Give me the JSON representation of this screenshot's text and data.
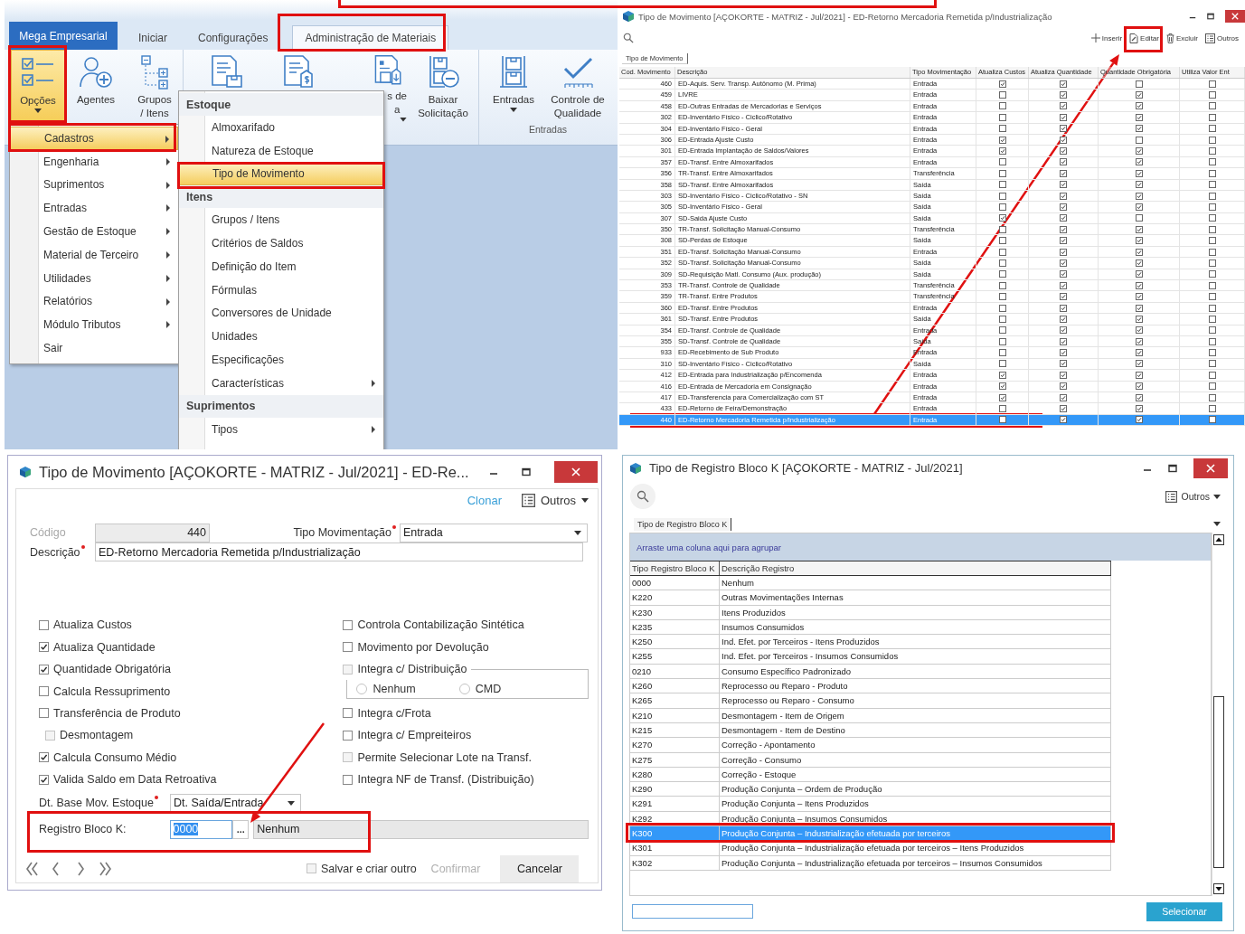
{
  "main_window": {
    "tabs": [
      {
        "label": "Mega Empresarial",
        "kind": "app",
        "selected": false
      },
      {
        "label": "Iniciar",
        "kind": "tab",
        "selected": false
      },
      {
        "label": "Configurações",
        "kind": "tab",
        "selected": false
      },
      {
        "label": "Administração de Materiais",
        "kind": "tab",
        "selected": true
      }
    ],
    "ribbon_groups": [
      {
        "buttons": [
          {
            "label_lines": [
              "Opções"
            ],
            "caret": true,
            "selected": true
          },
          {
            "label_lines": [
              "Agentes"
            ],
            "caret": false,
            "selected": false
          },
          {
            "label_lines": [
              "Grupos",
              "/ Itens"
            ],
            "caret": false,
            "selected": false
          }
        ]
      },
      {
        "buttons": [
          {
            "caret": false,
            "selected": false
          },
          {
            "caret": false,
            "selected": false
          },
          {
            "label_lines": [
              "s de",
              "a"
            ],
            "caret": true,
            "selected": false
          },
          {
            "label_lines": [
              "Baixar",
              "Solicitação"
            ],
            "caret": false,
            "selected": false
          }
        ]
      },
      {
        "caption": "Entradas",
        "buttons": [
          {
            "label_lines": [
              "Entradas"
            ],
            "caret": true,
            "selected": false
          },
          {
            "label_lines": [
              "Controle de",
              "Qualidade"
            ],
            "caret": false,
            "selected": false
          }
        ]
      }
    ],
    "menu": [
      {
        "label": "Cadastros",
        "has_submenu": true,
        "selected": true
      },
      {
        "label": "Engenharia",
        "has_submenu": true,
        "selected": false
      },
      {
        "label": "Suprimentos",
        "has_submenu": true,
        "selected": false
      },
      {
        "label": "Entradas",
        "has_submenu": true,
        "selected": false
      },
      {
        "label": "Gestão de Estoque",
        "has_submenu": true,
        "selected": false
      },
      {
        "label": "Material de Terceiro",
        "has_submenu": true,
        "selected": false
      },
      {
        "label": "Utilidades",
        "has_submenu": true,
        "selected": false
      },
      {
        "label": "Relatórios",
        "has_submenu": true,
        "selected": false
      },
      {
        "label": "Módulo Tributos",
        "has_submenu": true,
        "selected": false
      },
      {
        "label": "Sair",
        "has_submenu": false,
        "selected": false
      }
    ],
    "submenu": [
      {
        "header": "Estoque",
        "items": [
          {
            "label": "Almoxarifado",
            "has_submenu": false,
            "selected": false
          },
          {
            "label": "Natureza de Estoque",
            "has_submenu": false,
            "selected": false
          },
          {
            "label": "Tipo de Movimento",
            "has_submenu": false,
            "selected": true
          }
        ]
      },
      {
        "header": "Itens",
        "items": [
          {
            "label": "Grupos / Itens",
            "has_submenu": false,
            "selected": false
          },
          {
            "label": "Critérios de Saldos",
            "has_submenu": false,
            "selected": false
          },
          {
            "label": "Definição do Item",
            "has_submenu": false,
            "selected": false
          },
          {
            "label": "Fórmulas",
            "has_submenu": false,
            "selected": false
          },
          {
            "label": "Conversores de Unidade",
            "has_submenu": false,
            "selected": false
          },
          {
            "label": "Unidades",
            "has_submenu": false,
            "selected": false
          },
          {
            "label": "Especificações",
            "has_submenu": false,
            "selected": false
          },
          {
            "label": "Características",
            "has_submenu": true,
            "selected": false
          }
        ]
      },
      {
        "header": "Suprimentos",
        "items": [
          {
            "label": "Tipos",
            "has_submenu": true,
            "selected": false
          }
        ]
      }
    ]
  },
  "movement_list_window": {
    "title": "Tipo de Movimento [AÇOKORTE - MATRIZ - Jul/2021] - ED-Retorno Mercadoria Remetida p/Industrialização",
    "toolbar": [
      {
        "label": "Inserir"
      },
      {
        "label": "Editar"
      },
      {
        "label": "Excluir"
      },
      {
        "label": "Outros"
      }
    ],
    "tab": "Tipo de Movimento",
    "columns": [
      "Cod. Movimento",
      "Descrição",
      "Tipo Movimentação",
      "Atualiza Custos",
      "Atualiza Quantidade",
      "Quantidade Obrigatória",
      "Utiliza Valor Ent"
    ],
    "rows": [
      {
        "code": "460",
        "description": "ED-Aquis. Serv. Transp. Autônomo (M. Prima)",
        "type": "Entrada",
        "flags": [
          true,
          true,
          false,
          false
        ],
        "selected": false
      },
      {
        "code": "459",
        "description": "LIVRE",
        "type": "Entrada",
        "flags": [
          false,
          true,
          true,
          false
        ],
        "selected": false
      },
      {
        "code": "458",
        "description": "ED-Outras Entradas de Mercadorias e Serviços",
        "type": "Entrada",
        "flags": [
          false,
          true,
          true,
          false
        ],
        "selected": false
      },
      {
        "code": "302",
        "description": "ED-Inventário Físico - Ciclico/Rotativo",
        "type": "Entrada",
        "flags": [
          false,
          true,
          true,
          false
        ],
        "selected": false
      },
      {
        "code": "304",
        "description": "ED-Inventário Físico - Geral",
        "type": "Entrada",
        "flags": [
          false,
          true,
          true,
          false
        ],
        "selected": false
      },
      {
        "code": "306",
        "description": "ED-Entrada Ajuste Custo",
        "type": "Entrada",
        "flags": [
          true,
          true,
          false,
          false
        ],
        "selected": false
      },
      {
        "code": "301",
        "description": "ED-Entrada Implantação de Saldos/Valores",
        "type": "Entrada",
        "flags": [
          true,
          true,
          true,
          false
        ],
        "selected": false
      },
      {
        "code": "357",
        "description": "ED-Transf. Entre Almoxarifados",
        "type": "Entrada",
        "flags": [
          false,
          true,
          true,
          false
        ],
        "selected": false
      },
      {
        "code": "356",
        "description": "TR-Transf. Entre Almoxarifados",
        "type": "Transferência",
        "flags": [
          false,
          true,
          true,
          false
        ],
        "selected": false
      },
      {
        "code": "358",
        "description": "SD-Transf. Entre Almoxarifados",
        "type": "Saída",
        "flags": [
          false,
          true,
          true,
          false
        ],
        "selected": false
      },
      {
        "code": "303",
        "description": "SD-Inventário Físico - Ciclico/Rotativo - SN",
        "type": "Saída",
        "flags": [
          false,
          true,
          true,
          false
        ],
        "selected": false
      },
      {
        "code": "305",
        "description": "SD-Inventário Físico - Geral",
        "type": "Saída",
        "flags": [
          false,
          true,
          true,
          false
        ],
        "selected": false
      },
      {
        "code": "307",
        "description": "SD-Saida Ajuste Custo",
        "type": "Saída",
        "flags": [
          true,
          true,
          false,
          false
        ],
        "selected": false
      },
      {
        "code": "350",
        "description": "TR-Transf. Solicitação Manual-Consumo",
        "type": "Transferência",
        "flags": [
          false,
          true,
          true,
          false
        ],
        "selected": false
      },
      {
        "code": "308",
        "description": "SD-Perdas de Estoque",
        "type": "Saída",
        "flags": [
          false,
          true,
          true,
          false
        ],
        "selected": false
      },
      {
        "code": "351",
        "description": "ED-Transf. Solicitação Manual-Consumo",
        "type": "Entrada",
        "flags": [
          false,
          true,
          true,
          false
        ],
        "selected": false
      },
      {
        "code": "352",
        "description": "SD-Transf. Solicitação Manual-Consumo",
        "type": "Saída",
        "flags": [
          false,
          true,
          true,
          false
        ],
        "selected": false
      },
      {
        "code": "309",
        "description": "SD-Requisição Matl. Consumo (Aux. produção)",
        "type": "Saída",
        "flags": [
          false,
          true,
          true,
          false
        ],
        "selected": false
      },
      {
        "code": "353",
        "description": "TR-Transf. Controle de Qualidade",
        "type": "Transferência",
        "flags": [
          false,
          true,
          true,
          false
        ],
        "selected": false
      },
      {
        "code": "359",
        "description": "TR-Transf. Entre Produtos",
        "type": "Transferência",
        "flags": [
          false,
          true,
          true,
          false
        ],
        "selected": false
      },
      {
        "code": "360",
        "description": "ED-Transf. Entre Produtos",
        "type": "Entrada",
        "flags": [
          false,
          true,
          true,
          false
        ],
        "selected": false
      },
      {
        "code": "361",
        "description": "SD-Transf. Entre Produtos",
        "type": "Saída",
        "flags": [
          false,
          true,
          true,
          false
        ],
        "selected": false
      },
      {
        "code": "354",
        "description": "ED-Transf. Controle de Qualidade",
        "type": "Entrada",
        "flags": [
          false,
          true,
          true,
          false
        ],
        "selected": false
      },
      {
        "code": "355",
        "description": "SD-Transf. Controle de Qualidade",
        "type": "Saída",
        "flags": [
          false,
          true,
          true,
          false
        ],
        "selected": false
      },
      {
        "code": "933",
        "description": "ED-Recebimento de Sub Produto",
        "type": "Entrada",
        "flags": [
          false,
          true,
          true,
          false
        ],
        "selected": false
      },
      {
        "code": "310",
        "description": "SD-Inventário Físico - Ciclico/Rotativo",
        "type": "Saída",
        "flags": [
          false,
          true,
          true,
          false
        ],
        "selected": false
      },
      {
        "code": "412",
        "description": "ED-Entrada para Industrialização p/Encomenda",
        "type": "Entrada",
        "flags": [
          true,
          true,
          true,
          false
        ],
        "selected": false
      },
      {
        "code": "416",
        "description": "ED-Entrada de Mercadoria em Consignação",
        "type": "Entrada",
        "flags": [
          true,
          true,
          true,
          false
        ],
        "selected": false
      },
      {
        "code": "417",
        "description": "ED-Transferencia para Comercialização com ST",
        "type": "Entrada",
        "flags": [
          true,
          true,
          true,
          false
        ],
        "selected": false
      },
      {
        "code": "433",
        "description": "ED-Retorno de Feira/Demonstração",
        "type": "Entrada",
        "flags": [
          false,
          true,
          true,
          false
        ],
        "selected": false
      },
      {
        "code": "440",
        "description": "ED-Retorno Mercadoria Remetida p/Industrialização",
        "type": "Entrada",
        "flags": [
          false,
          true,
          true,
          false
        ],
        "selected": true
      }
    ]
  },
  "movement_dialog": {
    "title": "Tipo de Movimento [AÇOKORTE - MATRIZ - Jul/2021] - ED-Re...",
    "clone_link": "Clonar",
    "more_menu": "Outros",
    "code_field": {
      "label": "Código",
      "value": "440",
      "disabled": true
    },
    "movement_type_field": {
      "label": "Tipo Movimentação",
      "value": "Entrada",
      "required": true
    },
    "description_field": {
      "label": "Descrição",
      "value": "ED-Retorno Mercadoria Remetida p/Industrialização",
      "required": true
    },
    "left_options": [
      {
        "label": "Atualiza Custos",
        "checked": false,
        "disabled": false
      },
      {
        "label": "Atualiza Quantidade",
        "checked": true,
        "disabled": false
      },
      {
        "label": "Quantidade Obrigatória",
        "checked": true,
        "disabled": false
      },
      {
        "label": "Calcula Ressuprimento",
        "checked": false,
        "disabled": false
      },
      {
        "label": "Transferência de Produto",
        "checked": false,
        "disabled": false,
        "children": [
          {
            "label": "Desmontagem",
            "checked": false,
            "disabled": true
          }
        ]
      },
      {
        "label": "Calcula Consumo Médio",
        "checked": true,
        "disabled": false
      },
      {
        "label": "Valida Saldo em Data Retroativa",
        "checked": true,
        "disabled": false
      }
    ],
    "right_options": [
      {
        "kind": "check",
        "label": "Controla Contabilização Sintética",
        "checked": false,
        "disabled": false
      },
      {
        "kind": "check",
        "label": "Movimento por Devolução",
        "checked": false,
        "disabled": false
      },
      {
        "kind": "group",
        "label": "Integra c/ Distribuição",
        "checked": false,
        "disabled": true,
        "radios": [
          {
            "label": "Nenhum",
            "selected": false
          },
          {
            "label": "CMD",
            "selected": false
          }
        ]
      },
      {
        "kind": "check",
        "label": "Integra c/Frota",
        "checked": false,
        "disabled": false
      },
      {
        "kind": "check",
        "label": "Integra c/ Empreiteiros",
        "checked": false,
        "disabled": false
      },
      {
        "kind": "check",
        "label": "Permite Selecionar Lote na Transf.",
        "checked": false,
        "disabled": true
      },
      {
        "kind": "check",
        "label": "Integra NF de Transf. (Distribuição)",
        "checked": false,
        "disabled": false
      }
    ],
    "stock_date_field": {
      "label": "Dt. Base Mov. Estoque",
      "value": "Dt. Saída/Entrada",
      "required": true
    },
    "bloco_k_field": {
      "label": "Registro Bloco K:",
      "value": "0000",
      "value_selected": true,
      "browse": "...",
      "description": "Nenhum"
    },
    "save_and_new": {
      "label": "Salvar e criar outro",
      "checked": false,
      "disabled": true
    },
    "buttons": [
      {
        "label": "Confirmar",
        "disabled": true
      },
      {
        "label": "Cancelar",
        "disabled": false
      }
    ]
  },
  "bloco_k_window": {
    "title": "Tipo de Registro Bloco K [AÇOKORTE - MATRIZ - Jul/2021]",
    "more_menu": "Outros",
    "tab": "Tipo de Registro Bloco K",
    "group_hint": "Arraste uma coluna aqui para agrupar",
    "columns": [
      "Tipo Registro Bloco K",
      "Descrição Registro"
    ],
    "rows": [
      {
        "code": "0000",
        "description": "Nenhum",
        "selected": false
      },
      {
        "code": "K220",
        "description": "Outras Movimentações Internas",
        "selected": false
      },
      {
        "code": "K230",
        "description": "Itens Produzidos",
        "selected": false
      },
      {
        "code": "K235",
        "description": "Insumos Consumidos",
        "selected": false
      },
      {
        "code": "K250",
        "description": "Ind. Efet. por Terceiros - Itens Produzidos",
        "selected": false
      },
      {
        "code": "K255",
        "description": "Ind. Efet. por Terceiros - Insumos Consumidos",
        "selected": false
      },
      {
        "code": "0210",
        "description": "Consumo Específico Padronizado",
        "selected": false
      },
      {
        "code": "K260",
        "description": "Reprocesso ou Reparo - Produto",
        "selected": false
      },
      {
        "code": "K265",
        "description": "Reprocesso ou Reparo - Consumo",
        "selected": false
      },
      {
        "code": "K210",
        "description": "Desmontagem - Item de Origem",
        "selected": false
      },
      {
        "code": "K215",
        "description": "Desmontagem - Item de Destino",
        "selected": false
      },
      {
        "code": "K270",
        "description": "Correção - Apontamento",
        "selected": false
      },
      {
        "code": "K275",
        "description": "Correção - Consumo",
        "selected": false
      },
      {
        "code": "K280",
        "description": "Correção - Estoque",
        "selected": false
      },
      {
        "code": "K290",
        "description": "Produção Conjunta – Ordem de Produção",
        "selected": false
      },
      {
        "code": "K291",
        "description": "Produção Conjunta – Itens Produzidos",
        "selected": false
      },
      {
        "code": "K292",
        "description": "Produção Conjunta – Insumos Consumidos",
        "selected": false
      },
      {
        "code": "K300",
        "description": "Produção Conjunta – Industrialização efetuada por terceiros",
        "selected": true
      },
      {
        "code": "K301",
        "description": "Produção Conjunta – Industrialização efetuada por terceiros – Itens Produzidos",
        "selected": false
      },
      {
        "code": "K302",
        "description": "Produção Conjunta – Industrialização efetuada por terceiros – Insumos Consumidos",
        "selected": false
      }
    ],
    "action_button": "Selecionar"
  }
}
